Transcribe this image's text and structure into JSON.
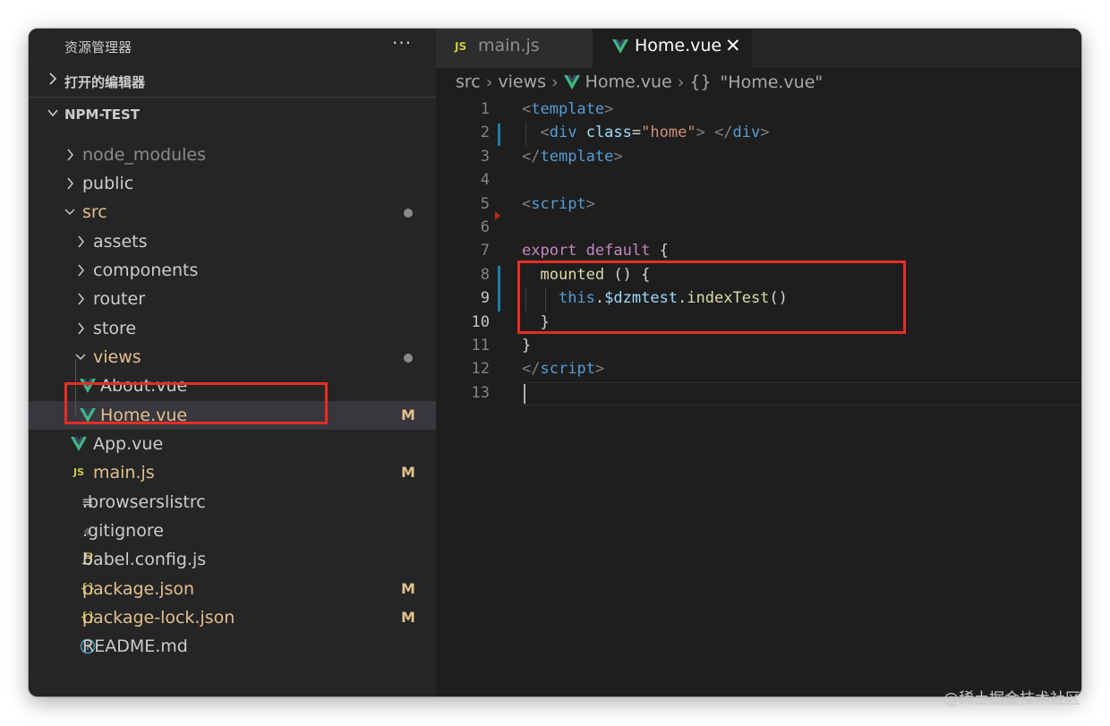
{
  "explorer": {
    "title": "资源管理器",
    "more": "···",
    "open_editors": "打开的编辑器",
    "project": "NPM-TEST",
    "files": [
      {
        "name": "node_modules",
        "kind": "folder",
        "open": false,
        "color": "#8b8b8b"
      },
      {
        "name": "public",
        "kind": "folder",
        "open": false,
        "color": "#cccccc"
      },
      {
        "name": "src",
        "kind": "folder",
        "open": true,
        "color": "#e2c08d",
        "dot": true
      },
      {
        "name": "assets",
        "kind": "folder",
        "open": false,
        "color": "#cccccc"
      },
      {
        "name": "components",
        "kind": "folder",
        "open": false,
        "color": "#cccccc"
      },
      {
        "name": "router",
        "kind": "folder",
        "open": false,
        "color": "#cccccc"
      },
      {
        "name": "store",
        "kind": "folder",
        "open": false,
        "color": "#cccccc"
      },
      {
        "name": "views",
        "kind": "folder",
        "open": true,
        "color": "#e2c08d",
        "dot": true
      },
      {
        "name": "About.vue",
        "kind": "vue",
        "color": "#cccccc"
      },
      {
        "name": "Home.vue",
        "kind": "vue",
        "color": "#e2c08d",
        "badge": "M",
        "selected": true
      },
      {
        "name": "App.vue",
        "kind": "vue",
        "color": "#cccccc"
      },
      {
        "name": "main.js",
        "kind": "js",
        "color": "#e2c08d",
        "badge": "M"
      },
      {
        "name": ".browserslistrc",
        "kind": "lines",
        "color": "#cccccc"
      },
      {
        "name": ".gitignore",
        "kind": "git",
        "color": "#cccccc"
      },
      {
        "name": "babel.config.js",
        "kind": "babel",
        "color": "#cccccc"
      },
      {
        "name": "package.json",
        "kind": "json",
        "color": "#e2c08d",
        "badge": "M"
      },
      {
        "name": "package-lock.json",
        "kind": "json",
        "color": "#e2c08d",
        "badge": "M"
      },
      {
        "name": "README.md",
        "kind": "info",
        "color": "#cccccc"
      }
    ]
  },
  "tabs": [
    {
      "label": "main.js",
      "icon": "JS",
      "active": false
    },
    {
      "label": "Home.vue",
      "active": true,
      "close": "✕"
    }
  ],
  "breadcrumb": {
    "parts": [
      "src",
      "views",
      "Home.vue",
      "{}",
      "\"Home.vue\""
    ],
    "sep": "›"
  },
  "code": {
    "lines": [
      {
        "n": "1",
        "tokens": [
          [
            "t-punc",
            "<"
          ],
          [
            "t-tag",
            "template"
          ],
          [
            "t-punc",
            ">"
          ]
        ]
      },
      {
        "n": "2",
        "tokens": [
          [
            "t-plain",
            "  "
          ],
          [
            "t-punc",
            "<"
          ],
          [
            "t-tag",
            "div"
          ],
          [
            "t-plain",
            " "
          ],
          [
            "t-attr",
            "class"
          ],
          [
            "t-plain",
            "="
          ],
          [
            "t-str",
            "\"home\""
          ],
          [
            "t-punc",
            ">"
          ],
          [
            "t-plain",
            " "
          ],
          [
            "t-punc",
            "</"
          ],
          [
            "t-tag",
            "div"
          ],
          [
            "t-punc",
            ">"
          ]
        ]
      },
      {
        "n": "3",
        "tokens": [
          [
            "t-punc",
            "</"
          ],
          [
            "t-tag",
            "template"
          ],
          [
            "t-punc",
            ">"
          ]
        ]
      },
      {
        "n": "4",
        "tokens": []
      },
      {
        "n": "5",
        "tokens": [
          [
            "t-punc",
            "<"
          ],
          [
            "t-tag",
            "script"
          ],
          [
            "t-punc",
            ">"
          ]
        ]
      },
      {
        "n": "6",
        "tokens": []
      },
      {
        "n": "7",
        "tokens": [
          [
            "t-kw",
            "export"
          ],
          [
            "t-plain",
            " "
          ],
          [
            "t-kw",
            "default"
          ],
          [
            "t-plain",
            " {"
          ]
        ]
      },
      {
        "n": "8",
        "tokens": [
          [
            "t-plain",
            "  "
          ],
          [
            "t-fn",
            "mounted"
          ],
          [
            "t-plain",
            " () {"
          ]
        ]
      },
      {
        "n": "9",
        "tokens": [
          [
            "t-plain",
            "    "
          ],
          [
            "t-this",
            "this"
          ],
          [
            "t-plain",
            "."
          ],
          [
            "t-var",
            "$dzmtest"
          ],
          [
            "t-plain",
            "."
          ],
          [
            "t-fn",
            "indexTest"
          ],
          [
            "t-plain",
            "()"
          ]
        ]
      },
      {
        "n": "10",
        "tokens": [
          [
            "t-plain",
            "  }"
          ]
        ]
      },
      {
        "n": "11",
        "tokens": [
          [
            "t-plain",
            "}"
          ]
        ]
      },
      {
        "n": "12",
        "tokens": [
          [
            "t-punc",
            "</"
          ],
          [
            "t-tag",
            "script"
          ],
          [
            "t-punc",
            ">"
          ]
        ]
      },
      {
        "n": "13",
        "tokens": []
      }
    ],
    "modified_lines": [
      "2",
      "8",
      "9"
    ],
    "current_line": "13"
  },
  "colors": {
    "accent_red": "#e52e26",
    "vue_green": "#41b883",
    "modified_yellow": "#e2c08d",
    "js_yellow": "#cbcb41"
  },
  "watermark": "@稀土掘金技术社区"
}
